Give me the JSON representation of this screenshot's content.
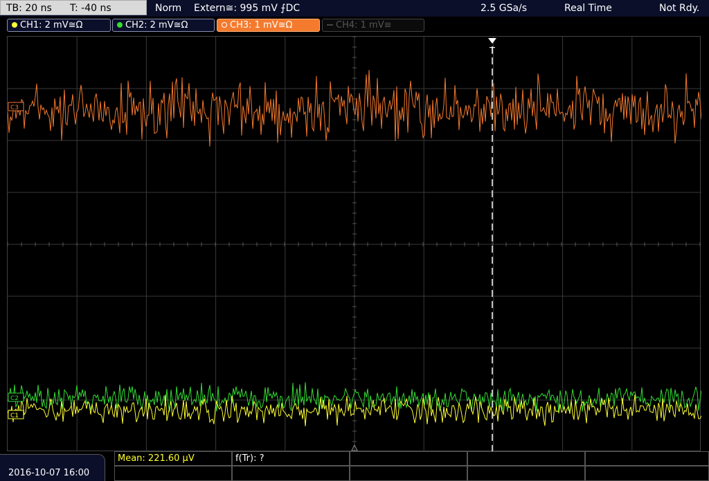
{
  "status_bar": {
    "timebase": "TB: 20 ns",
    "trigger_time": "T: -40 ns",
    "trigger_mode": "Norm",
    "trigger_source": "Extern≅: 995 mV ⨍DC",
    "sample_rate": "2.5 GSa/s",
    "acq_mode": "Real Time",
    "state": "Not Rdy."
  },
  "channels": [
    {
      "label": "CH1: 2 mV≅Ω",
      "color": "#ffff33",
      "state": "on"
    },
    {
      "label": "CH2: 2 mV≅Ω",
      "color": "#33dd33",
      "state": "on"
    },
    {
      "label": "CH3: 1 mV≅Ω",
      "color": "#f47a2e",
      "state": "active"
    },
    {
      "label": "CH4: 1 mV≅",
      "color": "#555555",
      "state": "off"
    }
  ],
  "markers": {
    "trigger": "T",
    "ch3_level": "C3",
    "ch2_level": "C2",
    "ch1_level": "C1"
  },
  "measurements": {
    "mean": "Mean: 221.60 µV",
    "f_tr": "f(Tr): ?"
  },
  "datetime": "2016-10-07 16:00",
  "colors": {
    "ch1": "#ffff33",
    "ch2": "#33dd33",
    "ch3": "#f47a2e",
    "grid": "#3a3a3a",
    "background": "#000000"
  }
}
